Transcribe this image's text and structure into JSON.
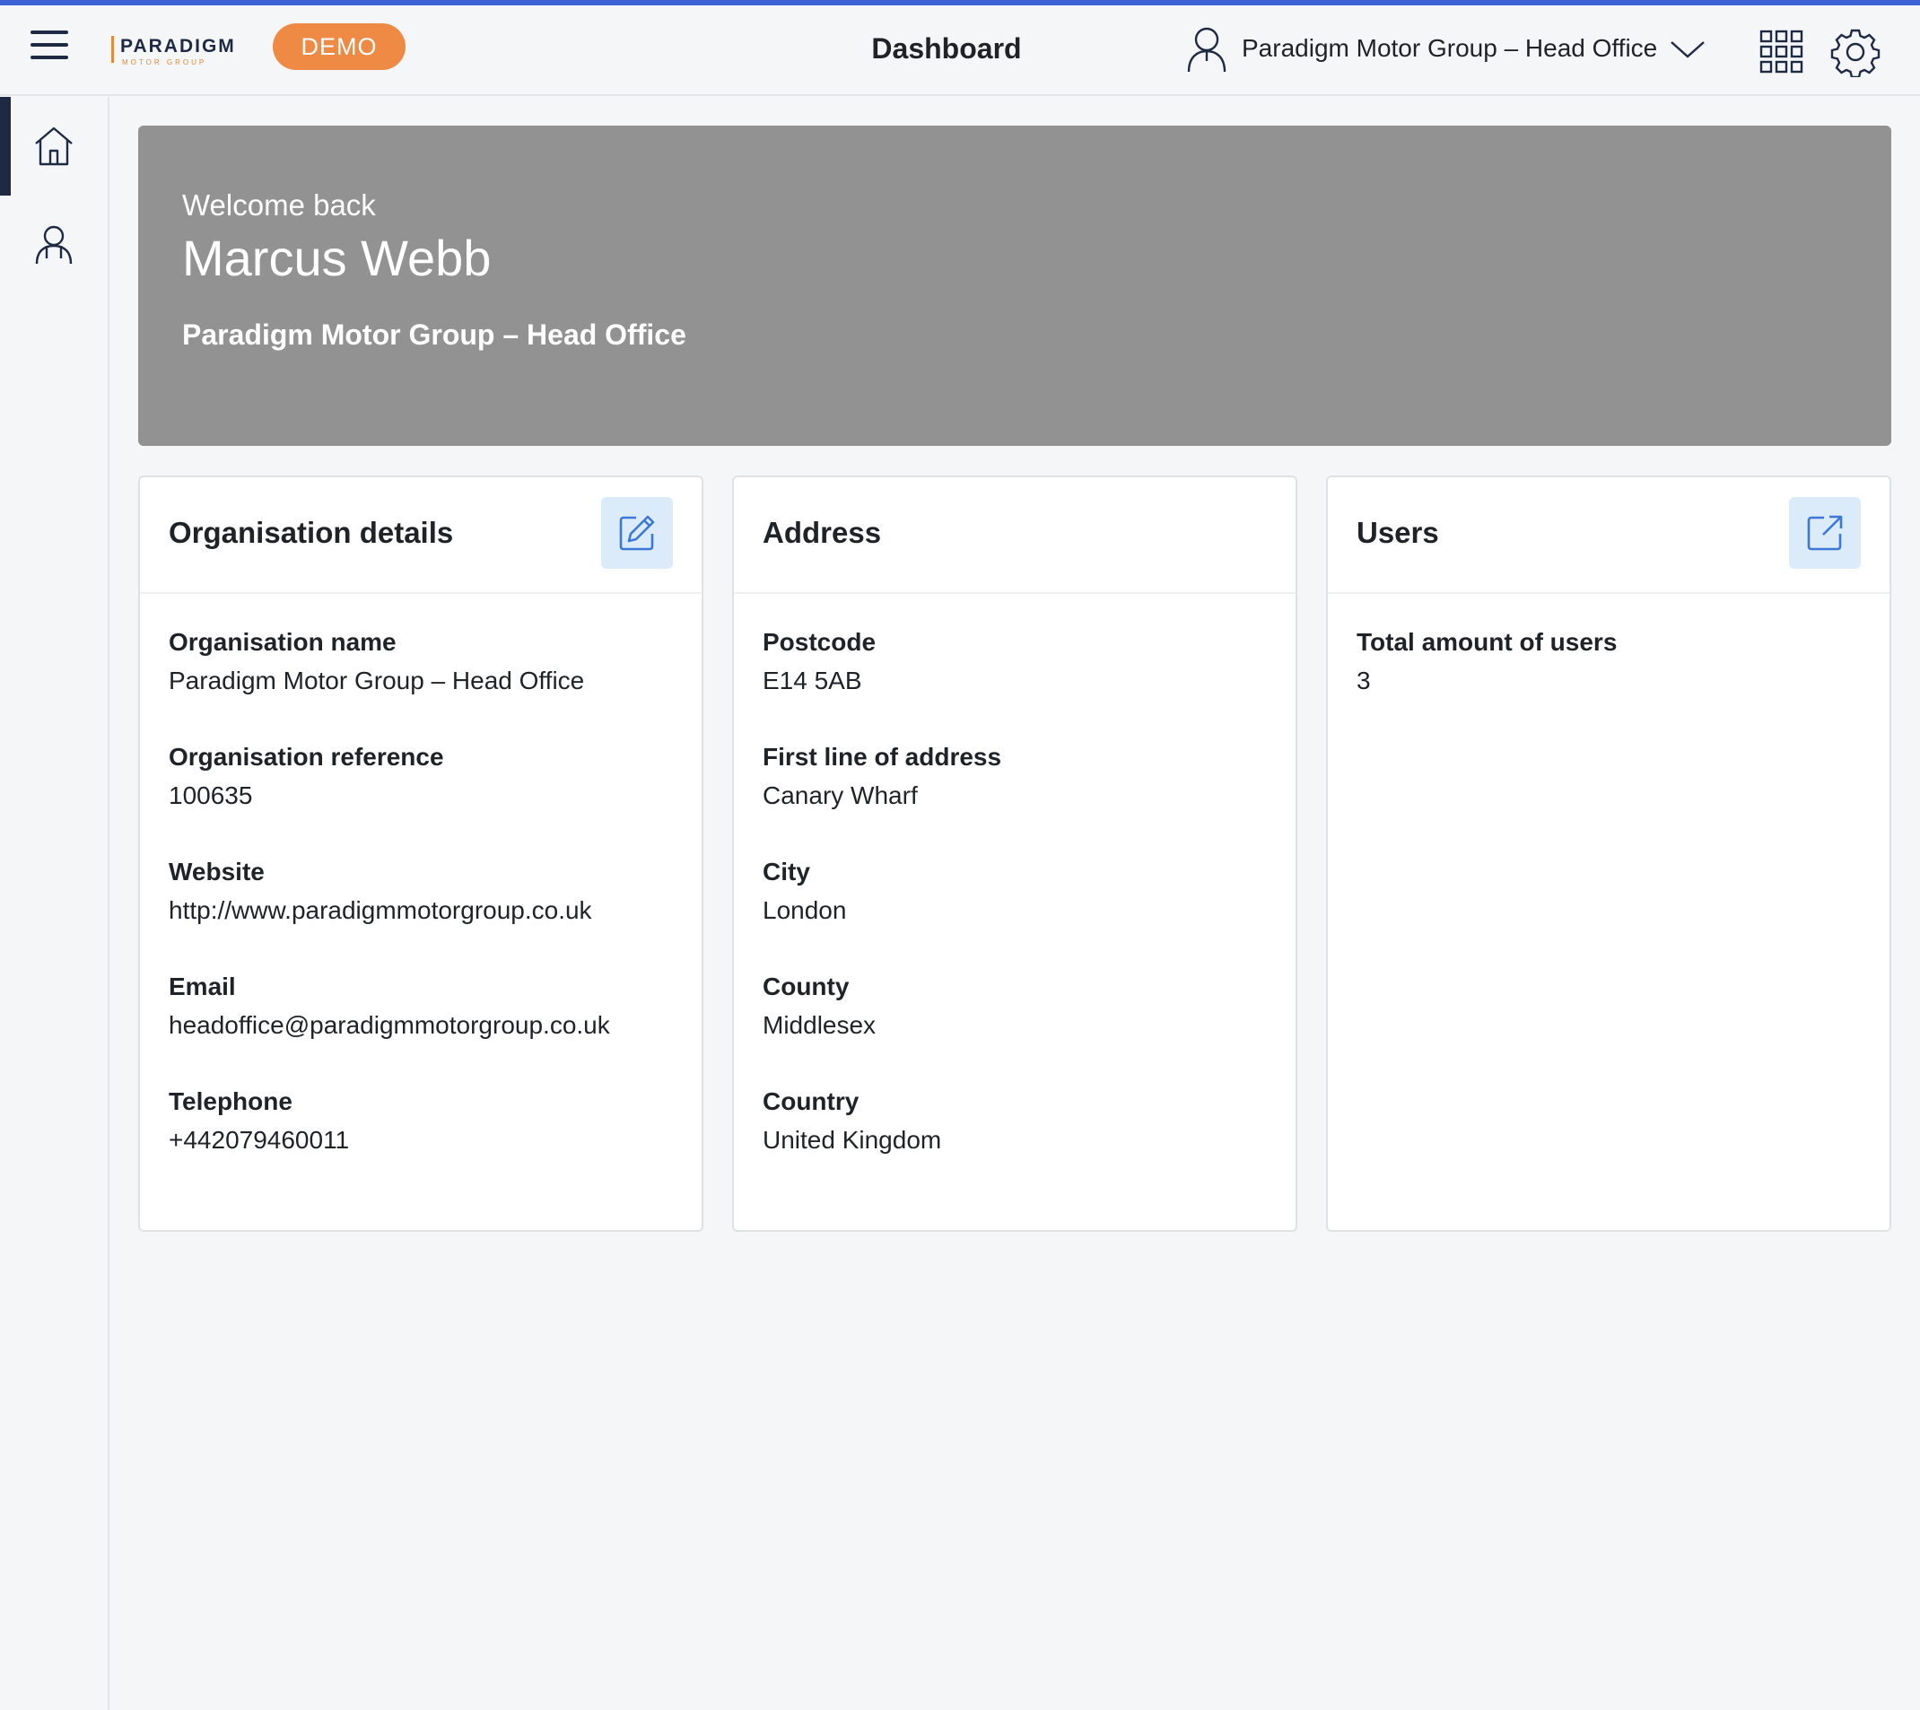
{
  "header": {
    "logo_text": "PARADIGM",
    "logo_sub": "MOTOR GROUP",
    "demo_label": "DEMO",
    "title": "Dashboard",
    "org_switcher": "Paradigm Motor Group – Head Office"
  },
  "sidebar": {
    "items": [
      {
        "icon": "home-icon",
        "active": true
      },
      {
        "icon": "users-icon",
        "active": false
      }
    ]
  },
  "banner": {
    "welcome": "Welcome back",
    "name": "Marcus Webb",
    "org": "Paradigm Motor Group – Head Office"
  },
  "cards": {
    "organisation": {
      "title": "Organisation details",
      "fields": [
        {
          "label": "Organisation name",
          "value": "Paradigm Motor Group – Head Office"
        },
        {
          "label": "Organisation reference",
          "value": "100635"
        },
        {
          "label": "Website",
          "value": "http://www.paradigmmotorgroup.co.uk"
        },
        {
          "label": "Email",
          "value": "headoffice@paradigmmotorgroup.co.uk"
        },
        {
          "label": "Telephone",
          "value": "+442079460011"
        }
      ]
    },
    "address": {
      "title": "Address",
      "fields": [
        {
          "label": "Postcode",
          "value": "E14 5AB"
        },
        {
          "label": "First line of address",
          "value": "Canary Wharf"
        },
        {
          "label": "City",
          "value": "London"
        },
        {
          "label": "County",
          "value": "Middlesex"
        },
        {
          "label": "Country",
          "value": "United Kingdom"
        }
      ]
    },
    "users": {
      "title": "Users",
      "fields": [
        {
          "label": "Total amount of users",
          "value": "3"
        }
      ]
    }
  },
  "colors": {
    "accent": "#3b63d6",
    "demo_badge": "#ee8a44",
    "banner": "#929292",
    "nav_dark": "#1e2a44",
    "icon_blue": "#3b78d8",
    "icon_button_bg": "#dcebfa"
  }
}
